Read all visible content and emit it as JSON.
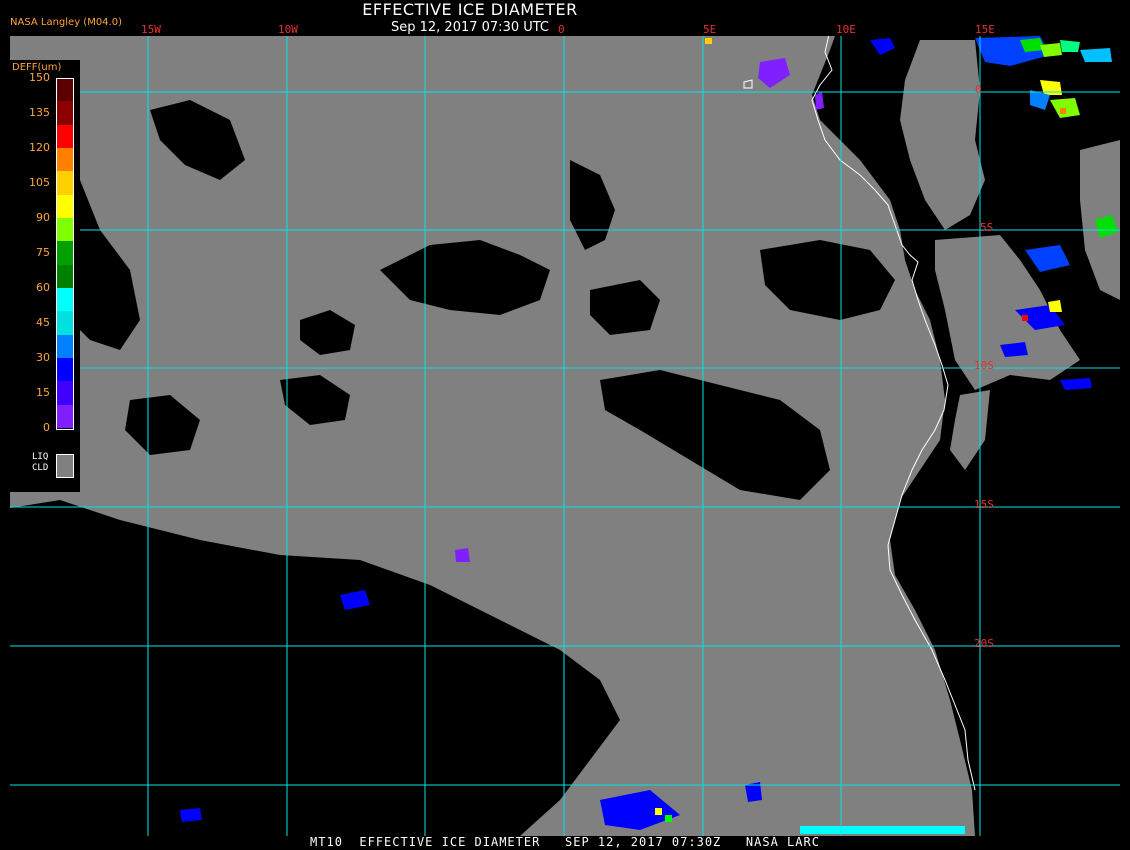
{
  "header": {
    "title": "EFFECTIVE ICE DIAMETER",
    "subtitle": "Sep 12, 2017 07:30 UTC",
    "source": "NASA Langley (M04.0)"
  },
  "map": {
    "longitude_labels": [
      "15W",
      "10W",
      "0",
      "5E",
      "10E",
      "15E"
    ],
    "latitude_labels": [
      "0",
      "5S",
      "10S",
      "15S",
      "20S"
    ],
    "colors": {
      "background": "#808080",
      "clear": "#000000",
      "grid": "#00e5e5",
      "coast": "#ffffff",
      "label": "#e83030"
    }
  },
  "legend": {
    "unit": "DEFF(um)",
    "ticks": [
      "150",
      "135",
      "120",
      "105",
      "90",
      "75",
      "60",
      "45",
      "30",
      "15",
      "0"
    ],
    "colors": [
      "#5a0000",
      "#8b0000",
      "#ff0000",
      "#ff8000",
      "#ffd000",
      "#ffff00",
      "#7fff00",
      "#00a000",
      "#008000",
      "#00ffff",
      "#00e0e0",
      "#0080ff",
      "#0000ff",
      "#4000ff",
      "#8020ff"
    ],
    "liquid_label_line1": "LIQ",
    "liquid_label_line2": "CLD",
    "liquid_color": "#808080"
  },
  "footer": {
    "text": "MT10  EFFECTIVE ICE DIAMETER   SEP 12, 2017 07:30Z   NASA LARC"
  }
}
